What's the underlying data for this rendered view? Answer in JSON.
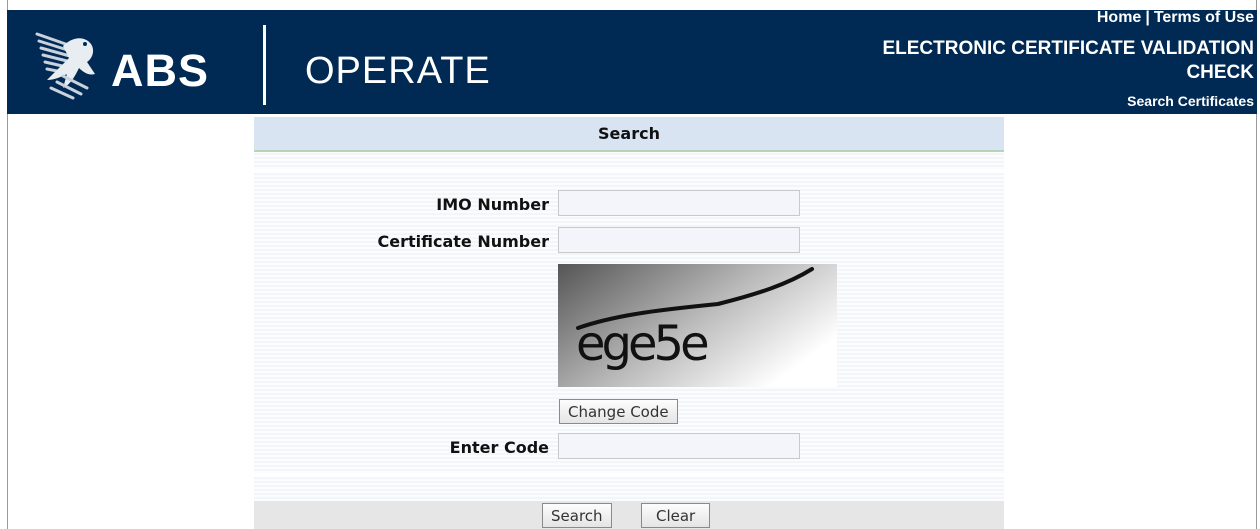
{
  "header": {
    "logo_text": "ABS",
    "product_name": "OPERATE",
    "links": {
      "home": "Home",
      "separator": "|",
      "terms": "Terms of Use"
    },
    "title_line1": "ELECTRONIC CERTIFICATE VALIDATION",
    "title_line2": "CHECK",
    "sub_link": "Search Certificates",
    "background_color": "#002a54",
    "logo_icon": "eagle-emblem-icon"
  },
  "search_form": {
    "heading": "Search",
    "imo_label": "IMO Number",
    "imo_value": "",
    "certificate_label": "Certificate Number",
    "certificate_value": "",
    "captcha_text": "ege5e",
    "change_code_label": "Change Code",
    "enter_code_label": "Enter Code",
    "enter_code_value": "",
    "search_button": "Search",
    "clear_button": "Clear"
  }
}
